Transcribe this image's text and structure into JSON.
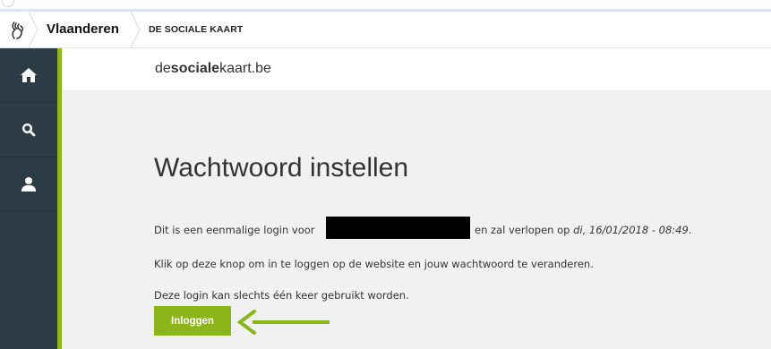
{
  "header": {
    "brand": "Vlaanderen",
    "breadcrumb": "DE SOCIALE KAART"
  },
  "subheader": {
    "site_name_pre": "de",
    "site_name_bold": "sociale",
    "site_name_post": "kaart.be"
  },
  "sidebar": {
    "items": [
      {
        "icon": "home-icon"
      },
      {
        "icon": "search-icon"
      },
      {
        "icon": "user-icon"
      }
    ]
  },
  "main": {
    "title": "Wachtwoord instellen",
    "line1_start": "Dit is een eenmalige login voor",
    "line1_middle": " en zal verlopen op ",
    "line1_date": "di, 16/01/2018 - 08:49",
    "line1_end": ".",
    "line2": "Klik op deze knop om in te loggen op de website en jouw wachtwoord te veranderen.",
    "line3": "Deze login kan slechts één keer gebruikt worden.",
    "login_button": "Inloggen"
  },
  "colors": {
    "accent": "#8bb51a",
    "sidebar": "#2b3c46",
    "arrow": "#8bb51a"
  }
}
